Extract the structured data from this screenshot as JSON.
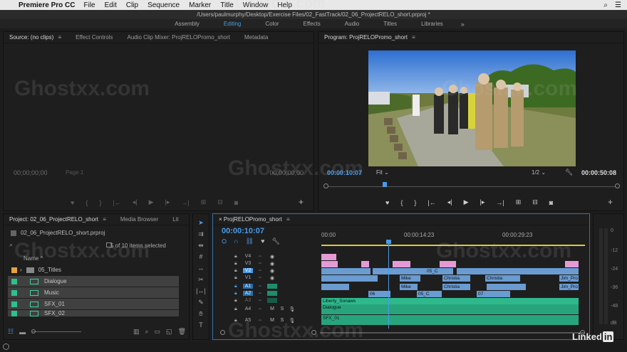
{
  "menubar": {
    "app": "Premiere Pro CC",
    "items": [
      "File",
      "Edit",
      "Clip",
      "Sequence",
      "Marker",
      "Title",
      "Window",
      "Help"
    ]
  },
  "titlebar": {
    "path": "/Users/paulmurphy/Desktop/Exercise Files/02_FastTrack/02_06_ProjectRELO_short.prproj *"
  },
  "workspaces": {
    "items": [
      {
        "label": "Assembly",
        "active": false
      },
      {
        "label": "Editing",
        "active": true
      },
      {
        "label": "Color",
        "active": false
      },
      {
        "label": "Effects",
        "active": false
      },
      {
        "label": "Audio",
        "active": false
      },
      {
        "label": "Titles",
        "active": false
      },
      {
        "label": "Libraries",
        "active": false
      }
    ],
    "more": "»"
  },
  "source": {
    "tabs": [
      "Source: (no clips)",
      "Effect Controls",
      "Audio Clip Mixer: ProjRELOPromo_short",
      "Metadata"
    ],
    "menu": "≡",
    "tc_left": "00;00;00;00",
    "page": "Page 1",
    "tc_right": "00;00;00;00",
    "add": "+"
  },
  "program": {
    "tab": "Program: ProjRELOPromo_short",
    "menu": "≡",
    "tc_current": "00:00:10:07",
    "fit": "Fit",
    "resolution": "1/2",
    "tc_duration": "00:00:50:08",
    "add": "+"
  },
  "project": {
    "tabs": [
      "Project: 02_06_ProjectRELO_short",
      "Media Browser",
      "Lit"
    ],
    "more": "»",
    "file": "02_06_ProjectRELO_short.prproj",
    "selected_count": "5 of 10 items selected",
    "name_header": "Name",
    "items": [
      {
        "name": "05_Titles",
        "color": "#e8a33a",
        "bin": true
      },
      {
        "name": "Dialogue",
        "color": "#2fbf8a",
        "bin": false
      },
      {
        "name": "Music",
        "color": "#2fbf8a",
        "bin": false
      },
      {
        "name": "SFX_01",
        "color": "#2fbf8a",
        "bin": false
      },
      {
        "name": "SFX_02",
        "color": "#2fbf8a",
        "bin": false
      }
    ]
  },
  "timeline": {
    "tab": "ProjRELOPromo_short",
    "menu": "≡",
    "close": "×",
    "tc": "00:00:10:07",
    "ruler": [
      "00:00",
      "00:00:14:23",
      "00:00:29:23"
    ],
    "tracks": [
      {
        "name": "V4",
        "type": "video"
      },
      {
        "name": "V3",
        "type": "video"
      },
      {
        "name": "V2",
        "type": "video"
      },
      {
        "name": "V1",
        "type": "video"
      },
      {
        "name": "A1",
        "type": "audio"
      },
      {
        "name": "A2",
        "type": "audio"
      },
      {
        "name": "A3",
        "type": "audio"
      },
      {
        "name": "A4",
        "type": "audio"
      },
      {
        "name": "A5",
        "type": "audio"
      }
    ],
    "clip_labels": {
      "mike1": "Mike",
      "o5c": "05_C",
      "christi1": "Christia",
      "jimpro1": "Jim_Pro",
      "o6": "06",
      "mike2": "Mike",
      "christi2": "Christia",
      "o5c2": "05_C",
      "o7": "07",
      "christi3": "Christia",
      "jimpro2": "Jim_Pro",
      "liberty": "Liberty_Sonaws",
      "dialogue": "Dialogue",
      "sfx01": "SFX_01"
    },
    "audio_toggles": [
      "M",
      "S"
    ]
  },
  "meters": {
    "labels": [
      "0",
      "-12",
      "-24",
      "-36",
      "-48",
      "dB"
    ]
  },
  "watermark": "Ghostxx.com",
  "branding": {
    "linkedin_a": "Linked",
    "linkedin_b": "in"
  }
}
